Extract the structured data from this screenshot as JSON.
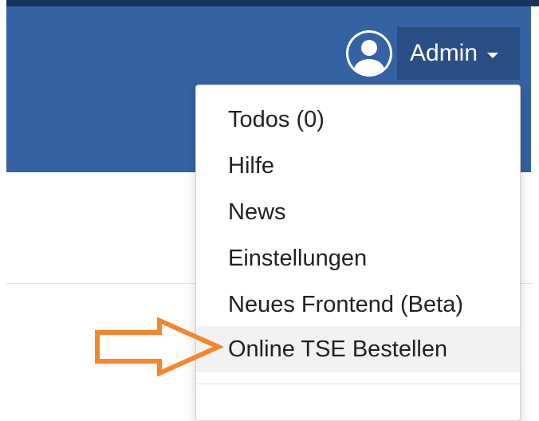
{
  "header": {
    "user_menu": {
      "label": "Admin",
      "avatar_icon": "user-circle-icon",
      "caret_icon": "caret-down-icon"
    }
  },
  "dropdown": {
    "items": [
      {
        "label": "Todos (0)"
      },
      {
        "label": "Hilfe"
      },
      {
        "label": "News"
      },
      {
        "label": "Einstellungen"
      },
      {
        "label": "Neues Frontend (Beta)"
      },
      {
        "label": "Online TSE Bestellen",
        "highlighted": true
      }
    ]
  },
  "annotation": {
    "arrow_color": "#f5862b",
    "arrow_icon": "arrow-right-icon"
  },
  "colors": {
    "navbar": "#3562a3",
    "admin_button": "#2b4f85",
    "accent_arrow": "#f5862b"
  }
}
